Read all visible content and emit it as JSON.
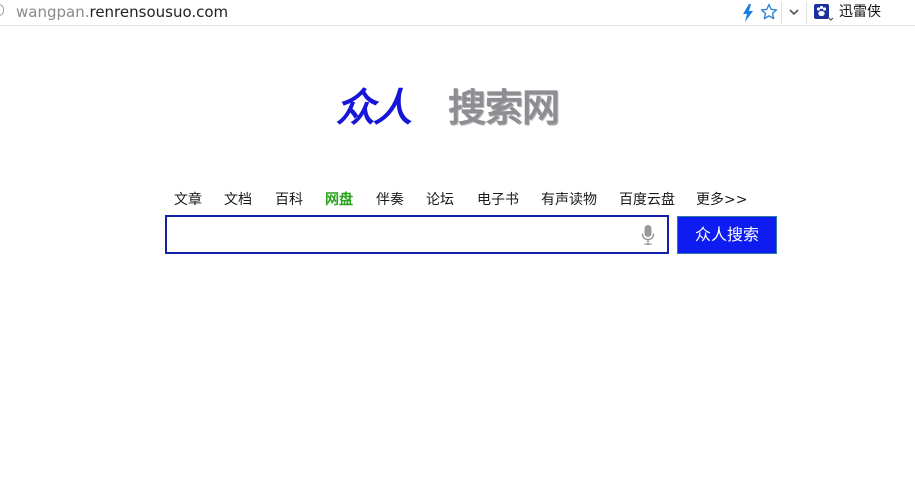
{
  "browser": {
    "url_prefix": "wangpan.",
    "url_domain": "renrensousuo.com",
    "extension_label": "迅雷侠"
  },
  "logo": {
    "part_a": "众人",
    "part_b": "搜索网"
  },
  "nav": {
    "items": [
      {
        "label": "文章",
        "active": false
      },
      {
        "label": "文档",
        "active": false
      },
      {
        "label": "百科",
        "active": false
      },
      {
        "label": "网盘",
        "active": true
      },
      {
        "label": "伴奏",
        "active": false
      },
      {
        "label": "论坛",
        "active": false
      },
      {
        "label": "电子书",
        "active": false
      },
      {
        "label": "有声读物",
        "active": false
      },
      {
        "label": "百度云盘",
        "active": false
      },
      {
        "label": "更多>>",
        "active": false
      }
    ]
  },
  "search": {
    "value": "",
    "button_label": "众人搜索"
  },
  "colors": {
    "active_nav": "#2aa31c",
    "button_bg": "#0d1cf0",
    "box_border": "#1320a8",
    "logo_blue": "#1616d8",
    "logo_gray": "#8e8e92"
  },
  "icons": [
    "bolt-icon",
    "star-icon",
    "chevron-down-icon",
    "baidu-paw-icon",
    "microphone-icon"
  ]
}
